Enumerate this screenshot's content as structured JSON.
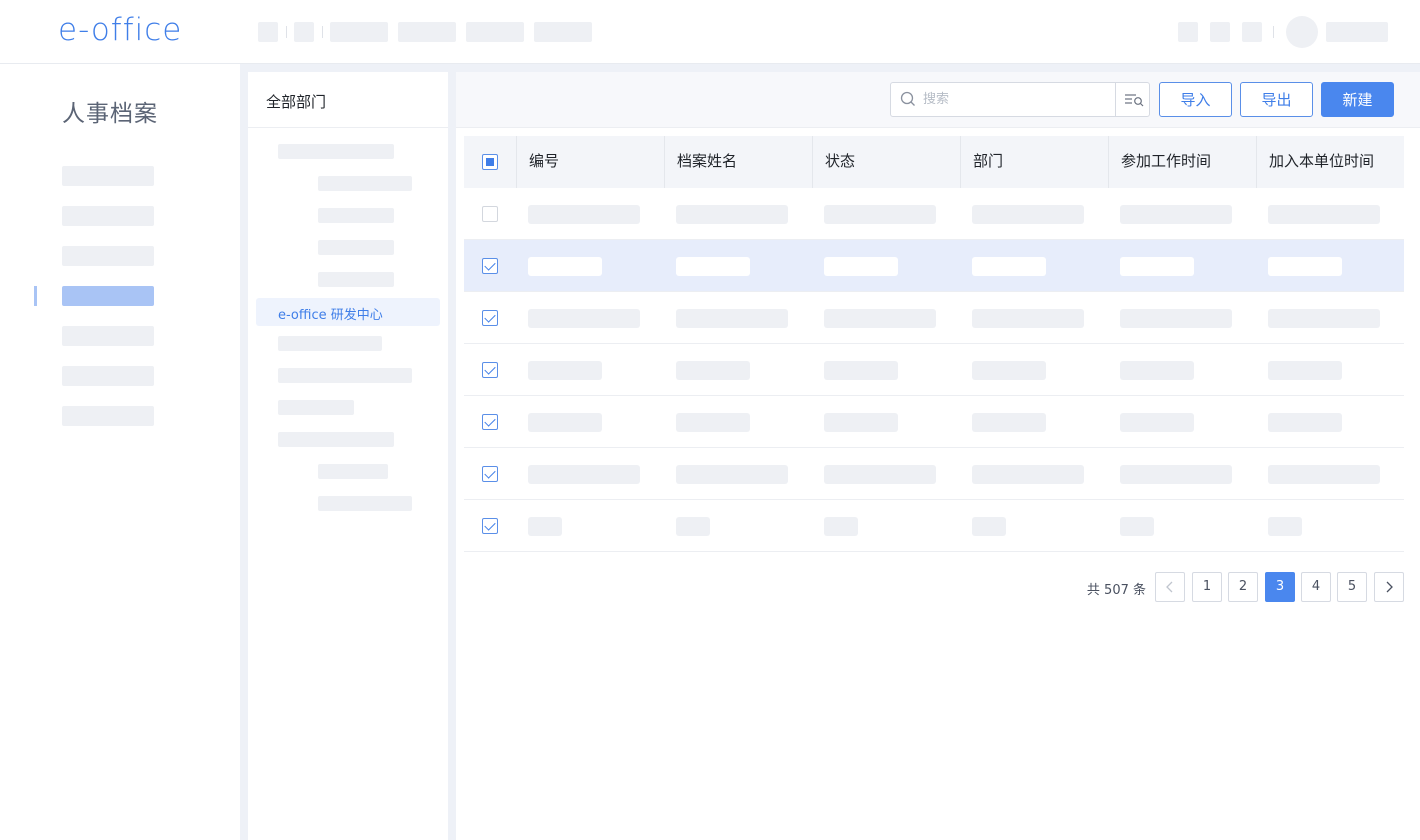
{
  "app": {
    "logo": "e-office"
  },
  "sidebar": {
    "module_title": "人事档案"
  },
  "departments": {
    "header": "全部部门",
    "selected": "e-office 研发中心"
  },
  "toolbar": {
    "search_placeholder": "搜索",
    "import_label": "导入",
    "export_label": "导出",
    "new_label": "新建"
  },
  "table": {
    "columns": [
      "编号",
      "档案姓名",
      "状态",
      "部门",
      "参加工作时间",
      "加入本单位时间"
    ],
    "header_checkbox": "partial",
    "rows_checked": [
      false,
      true,
      true,
      true,
      true,
      true,
      true
    ],
    "highlighted_row": 1
  },
  "pagination": {
    "total_text": "共 507 条",
    "pages": [
      "1",
      "2",
      "3",
      "4",
      "5"
    ],
    "current_page": "3"
  },
  "colors": {
    "accent": "#4a87ee",
    "text": "#1f2329",
    "placeholder": "#eef0f4"
  }
}
